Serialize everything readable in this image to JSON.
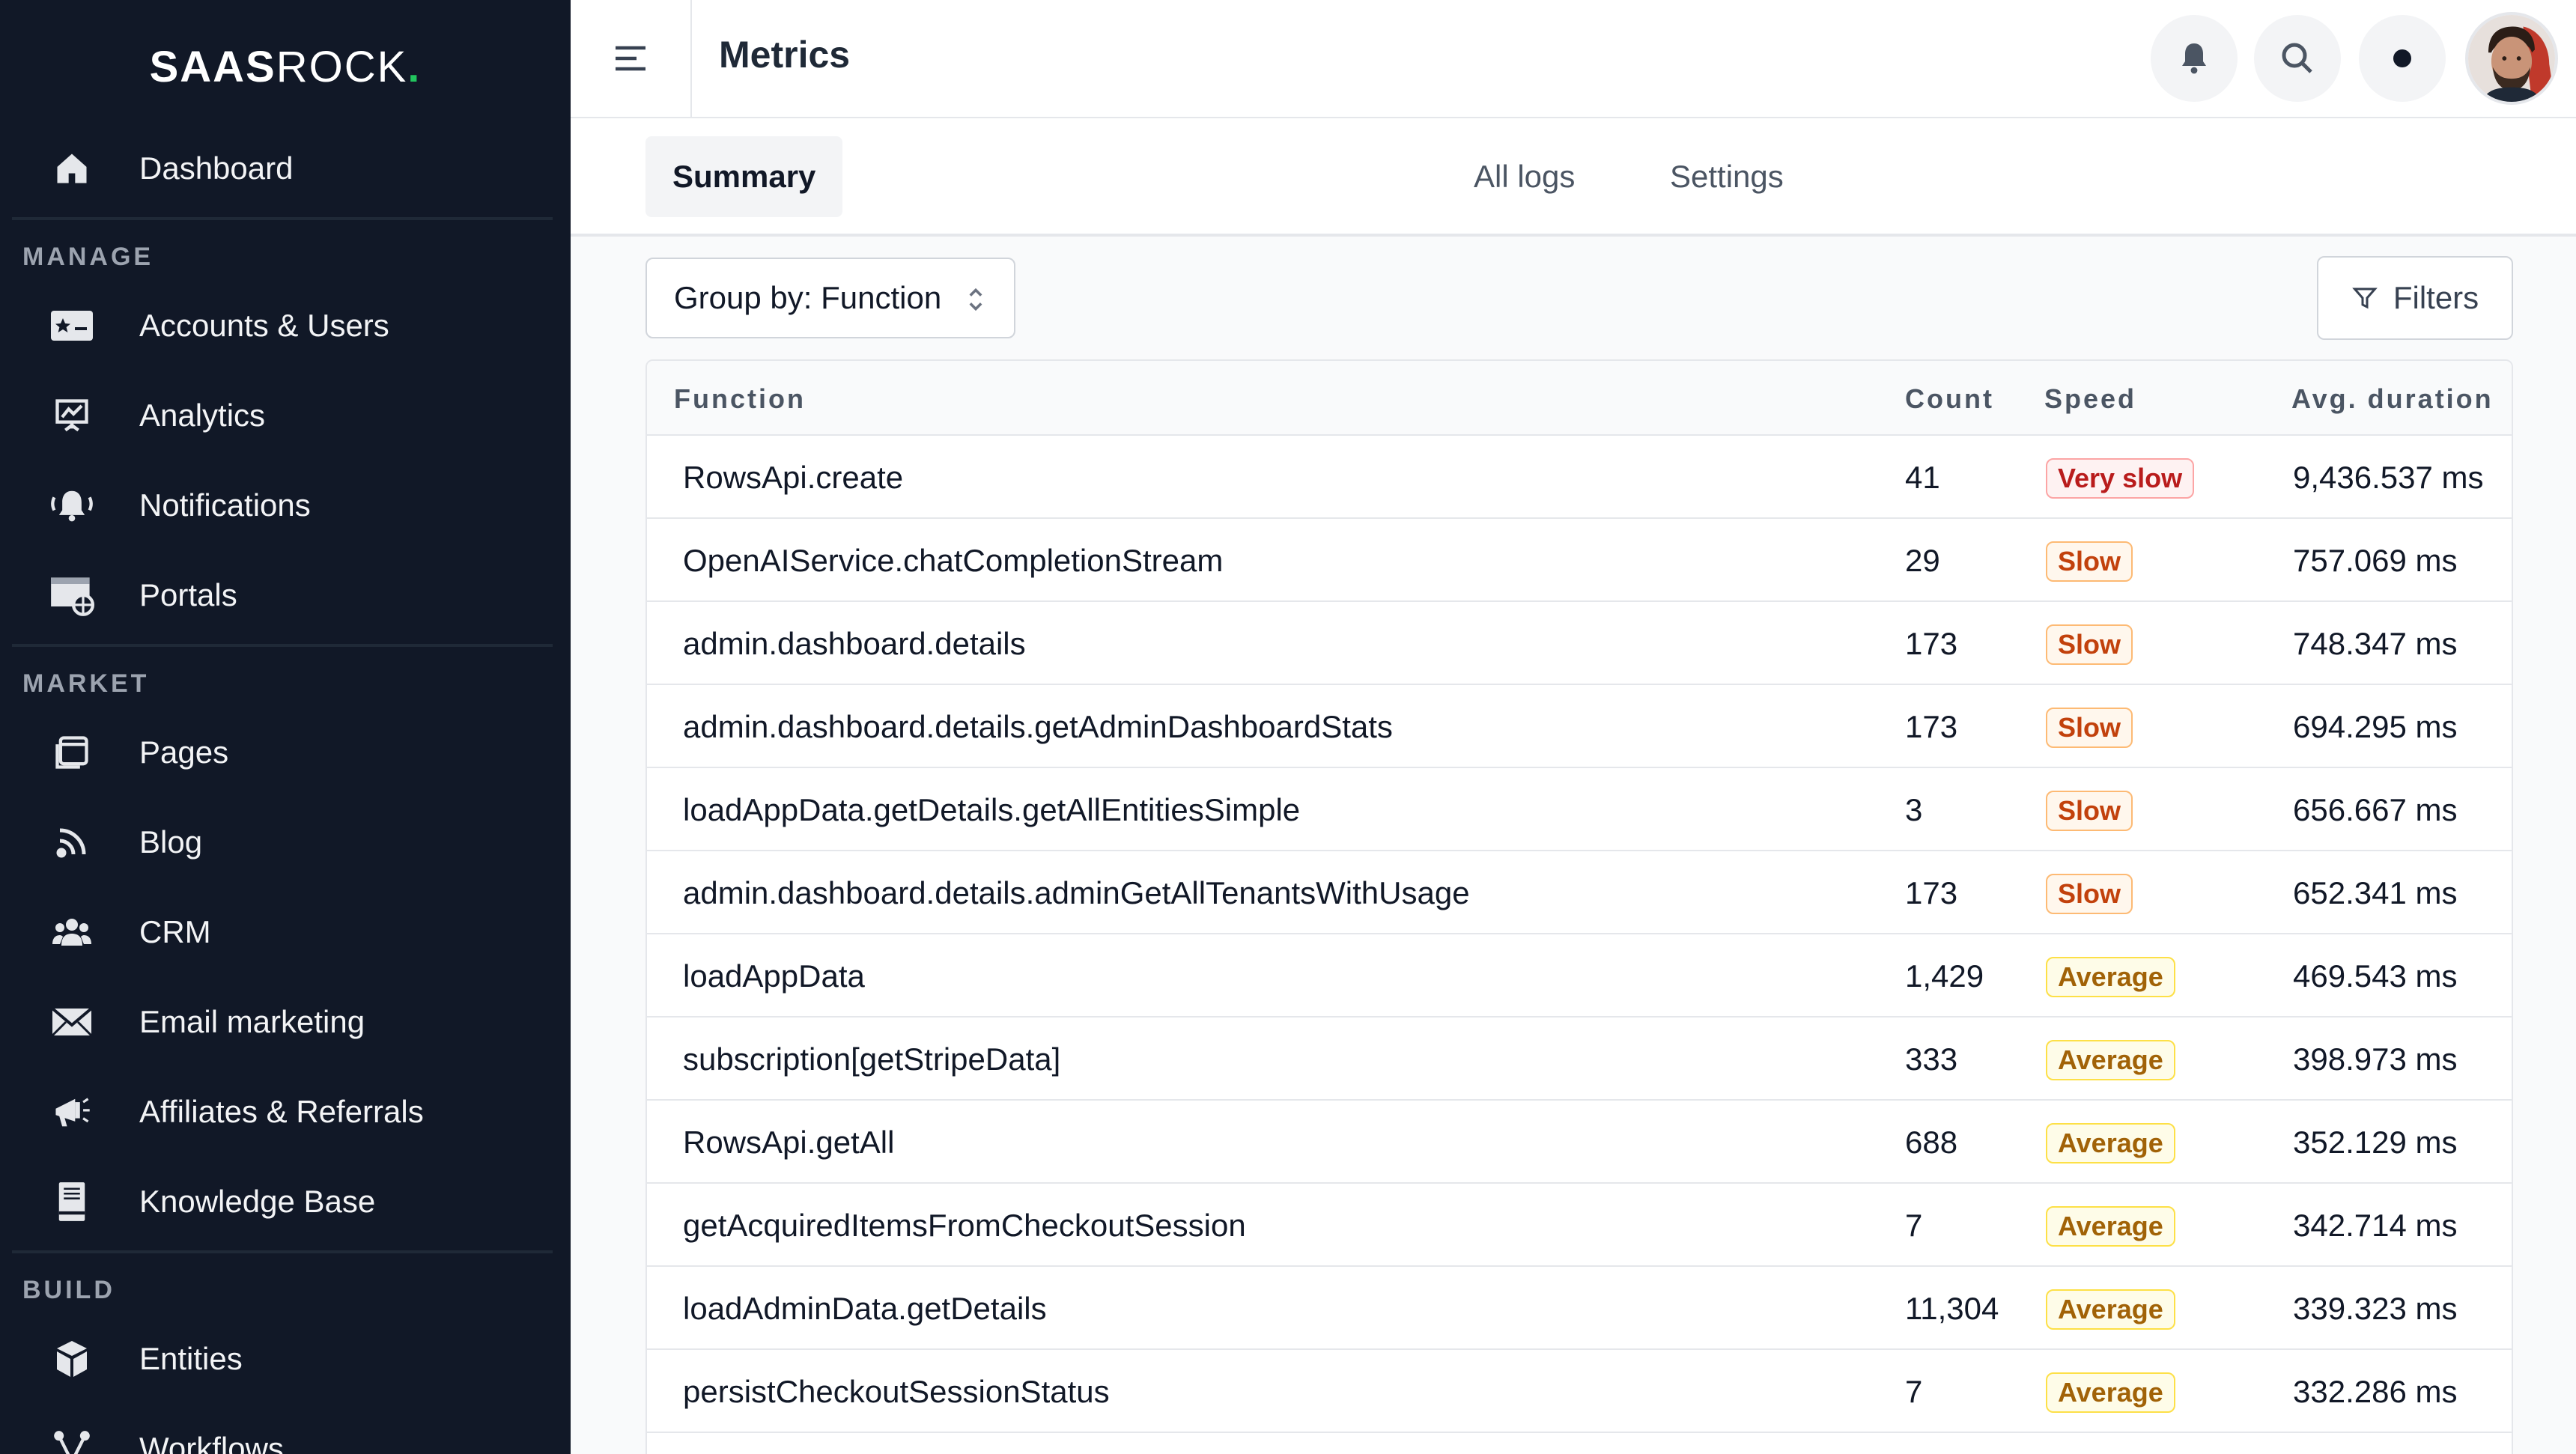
{
  "app": {
    "logo_bold": "SAAS",
    "logo_light": "ROCK",
    "logo_dot": "."
  },
  "sidebar": {
    "dashboard": {
      "label": "Dashboard",
      "icon": "home-icon"
    },
    "sections": [
      {
        "title": "MANAGE",
        "items": [
          {
            "label": "Accounts & Users",
            "icon": "id-card-icon"
          },
          {
            "label": "Analytics",
            "icon": "presentation-chart-icon"
          },
          {
            "label": "Notifications",
            "icon": "bell-ringing-icon"
          },
          {
            "label": "Portals",
            "icon": "browser-globe-icon"
          }
        ]
      },
      {
        "title": "MARKET",
        "items": [
          {
            "label": "Pages",
            "icon": "pages-icon"
          },
          {
            "label": "Blog",
            "icon": "rss-icon"
          },
          {
            "label": "CRM",
            "icon": "people-icon"
          },
          {
            "label": "Email marketing",
            "icon": "envelope-icon"
          },
          {
            "label": "Affiliates & Referrals",
            "icon": "megaphone-icon"
          },
          {
            "label": "Knowledge Base",
            "icon": "book-icon"
          }
        ]
      },
      {
        "title": "BUILD",
        "items": [
          {
            "label": "Entities",
            "icon": "cube-icon"
          },
          {
            "label": "Workflows",
            "icon": "workflow-icon"
          }
        ]
      }
    ]
  },
  "header": {
    "title": "Metrics"
  },
  "tabs": [
    {
      "label": "Summary",
      "active": true
    },
    {
      "label": "All logs",
      "active": false
    },
    {
      "label": "Settings",
      "active": false
    }
  ],
  "toolbar": {
    "group_by": "Group by: Function",
    "filters": "Filters"
  },
  "table": {
    "columns": [
      "Function",
      "Count",
      "Speed",
      "Avg. duration"
    ],
    "rows": [
      {
        "function": "RowsApi.create",
        "count": "41",
        "speed": "Very slow",
        "duration": "9,436.537 ms"
      },
      {
        "function": "OpenAIService.chatCompletionStream",
        "count": "29",
        "speed": "Slow",
        "duration": "757.069 ms"
      },
      {
        "function": "admin.dashboard.details",
        "count": "173",
        "speed": "Slow",
        "duration": "748.347 ms"
      },
      {
        "function": "admin.dashboard.details.getAdminDashboardStats",
        "count": "173",
        "speed": "Slow",
        "duration": "694.295 ms"
      },
      {
        "function": "loadAppData.getDetails.getAllEntitiesSimple",
        "count": "3",
        "speed": "Slow",
        "duration": "656.667 ms"
      },
      {
        "function": "admin.dashboard.details.adminGetAllTenantsWithUsage",
        "count": "173",
        "speed": "Slow",
        "duration": "652.341 ms"
      },
      {
        "function": "loadAppData",
        "count": "1,429",
        "speed": "Average",
        "duration": "469.543 ms"
      },
      {
        "function": "subscription[getStripeData]",
        "count": "333",
        "speed": "Average",
        "duration": "398.973 ms"
      },
      {
        "function": "RowsApi.getAll",
        "count": "688",
        "speed": "Average",
        "duration": "352.129 ms"
      },
      {
        "function": "getAcquiredItemsFromCheckoutSession",
        "count": "7",
        "speed": "Average",
        "duration": "342.714 ms"
      },
      {
        "function": "loadAdminData.getDetails",
        "count": "11,304",
        "speed": "Average",
        "duration": "339.323 ms"
      },
      {
        "function": "persistCheckoutSessionStatus",
        "count": "7",
        "speed": "Average",
        "duration": "332.286 ms"
      }
    ]
  },
  "colors": {
    "sidebar_bg": "#111827",
    "accent_dot": "#22c55e",
    "very_slow": "#b91c1c",
    "slow": "#c2410c",
    "average": "#a16207"
  }
}
